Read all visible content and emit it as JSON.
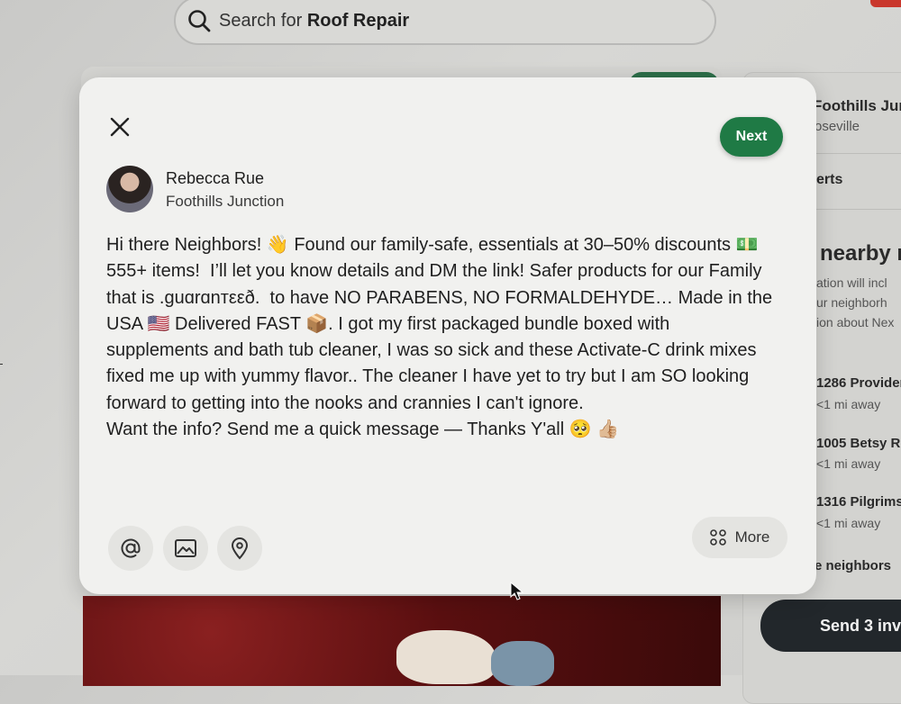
{
  "search": {
    "prefix": "Search for ",
    "term": "Roof Repair"
  },
  "right_panel": {
    "group_name": "Foothills Jun",
    "group_city": "oseville",
    "alerts_label": "erts",
    "nearby_heading": "nearby r",
    "nearby_desc_1": "ation will incl",
    "nearby_desc_2": "ur neighborh",
    "nearby_desc_3": "ion about Nex",
    "addresses": [
      {
        "street": "1286 Provider",
        "distance": "<1 mi away"
      },
      {
        "street": "1005 Betsy Ro",
        "distance": "<1 mi away"
      },
      {
        "street": "1316 Pilgrims",
        "distance": "<1 mi away"
      }
    ],
    "neighbors_label": "e neighbors",
    "send_button": "Send 3 invi"
  },
  "composer": {
    "next_label": "Next",
    "author": {
      "name": "Rebecca Rue",
      "neighborhood": "Foothills Junction"
    },
    "body": "Hi there Neighbors! 👋 Found our family-safe, essentials at 30–50% discounts 💵\n555+ items!  I’ll let you know details and DM the link! Safer products for our Family\nthat is .ɡuɑrɑnтεεð.  to have NO PARABENS, NO FORMALDEHYDE… Made in the\nUSA 🇺🇸 Delivered FAST 📦. I got my first packaged bundle boxed with\nsupplements and bath tub cleaner, I was so sick and these Activate-C drink mixes\nfixed me up with yummy flavor.. The cleaner I have yet to try but I am SO looking\nforward to getting into the nooks and crannies I can't ignore.\nWant the info? Send me a quick message — Thanks Y'all 🥺 👍🏼",
    "more_label": "More",
    "icons": [
      "close-icon",
      "mention-icon",
      "image-icon",
      "location-pin-icon",
      "grid-icon",
      "search-icon"
    ]
  },
  "colors": {
    "next_green": "#1f7a45",
    "send_dark": "#22272b",
    "modal_bg": "#f1f1ef"
  }
}
